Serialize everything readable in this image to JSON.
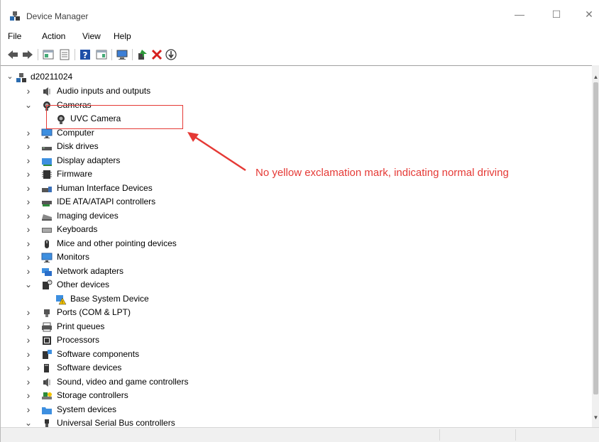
{
  "window": {
    "title": "Device Manager",
    "controls": {
      "minimize": "—",
      "maximize": "☐",
      "close": "✕"
    }
  },
  "menu": {
    "items": [
      "File",
      "Action",
      "View",
      "Help"
    ]
  },
  "toolbar": {
    "buttons": [
      "back-icon",
      "forward-icon",
      "show-hide-console-tree-icon",
      "properties-icon",
      "help-icon",
      "action-pane-icon",
      "scan-hardware-icon",
      "update-driver-icon",
      "uninstall-icon",
      "download-icon"
    ]
  },
  "tree": {
    "root": "d20211024",
    "items": [
      {
        "label": "Audio inputs and outputs",
        "icon": "speaker-icon",
        "expanded": false
      },
      {
        "label": "Cameras",
        "icon": "camera-icon",
        "expanded": true
      },
      {
        "label": "UVC Camera",
        "icon": "camera-icon",
        "child": true
      },
      {
        "label": "Computer",
        "icon": "monitor-icon",
        "expanded": false
      },
      {
        "label": "Disk drives",
        "icon": "disk-icon",
        "expanded": false
      },
      {
        "label": "Display adapters",
        "icon": "display-adapter-icon",
        "expanded": false
      },
      {
        "label": "Firmware",
        "icon": "firmware-icon",
        "expanded": false
      },
      {
        "label": "Human Interface Devices",
        "icon": "hid-icon",
        "expanded": false
      },
      {
        "label": "IDE ATA/ATAPI controllers",
        "icon": "ide-icon",
        "expanded": false
      },
      {
        "label": "Imaging devices",
        "icon": "scanner-icon",
        "expanded": false
      },
      {
        "label": "Keyboards",
        "icon": "keyboard-icon",
        "expanded": false
      },
      {
        "label": "Mice and other pointing devices",
        "icon": "mouse-icon",
        "expanded": false
      },
      {
        "label": "Monitors",
        "icon": "monitor-icon",
        "expanded": false
      },
      {
        "label": "Network adapters",
        "icon": "network-icon",
        "expanded": false
      },
      {
        "label": "Other devices",
        "icon": "unknown-device-icon",
        "expanded": true
      },
      {
        "label": "Base System Device",
        "icon": "warning-device-icon",
        "child": true
      },
      {
        "label": "Ports (COM & LPT)",
        "icon": "port-icon",
        "expanded": false
      },
      {
        "label": "Print queues",
        "icon": "printer-icon",
        "expanded": false
      },
      {
        "label": "Processors",
        "icon": "processor-icon",
        "expanded": false
      },
      {
        "label": "Software components",
        "icon": "software-component-icon",
        "expanded": false
      },
      {
        "label": "Software devices",
        "icon": "software-device-icon",
        "expanded": false
      },
      {
        "label": "Sound, video and game controllers",
        "icon": "speaker-icon",
        "expanded": false
      },
      {
        "label": "Storage controllers",
        "icon": "storage-icon",
        "expanded": false
      },
      {
        "label": "System devices",
        "icon": "folder-icon",
        "expanded": false
      },
      {
        "label": "Universal Serial Bus controllers",
        "icon": "usb-icon",
        "expanded": true
      }
    ]
  },
  "annotation": {
    "text": "No yellow exclamation mark, indicating normal driving",
    "color": "#e53935"
  }
}
